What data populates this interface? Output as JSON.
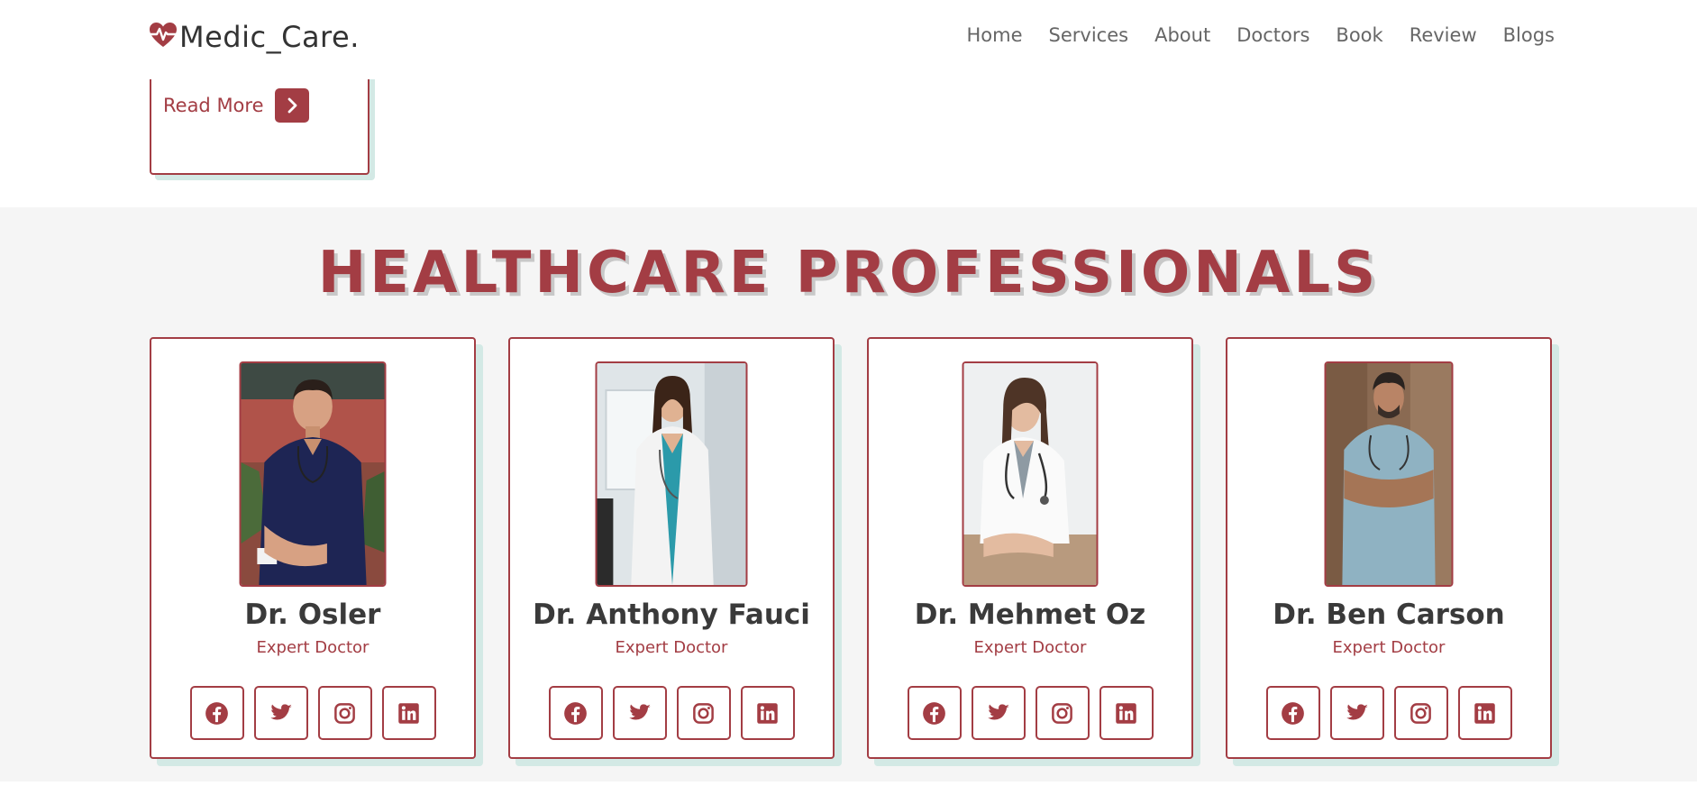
{
  "header": {
    "logo_icon": "heartbeat-icon",
    "logo_text": "Medic_Care.",
    "nav": [
      "Home",
      "Services",
      "About",
      "Doctors",
      "Book",
      "Review",
      "Blogs"
    ]
  },
  "blog": {
    "read_more_label": "Read More",
    "read_more_icon": "chevron-right-icon"
  },
  "section": {
    "title": "HEALTHCARE PROFESSIONALS"
  },
  "doctors": [
    {
      "name": "Dr. Osler",
      "role": "Expert Doctor",
      "photo": "doctor-in-navy-scrubs-photo"
    },
    {
      "name": "Dr. Anthony Fauci",
      "role": "Expert Doctor",
      "photo": "doctor-in-white-coat-standing-photo"
    },
    {
      "name": "Dr. Mehmet Oz",
      "role": "Expert Doctor",
      "photo": "doctor-seated-at-desk-photo"
    },
    {
      "name": "Dr. Ben Carson",
      "role": "Expert Doctor",
      "photo": "doctor-in-blue-scrubs-arms-crossed-photo"
    }
  ],
  "social_icons": [
    "facebook-icon",
    "twitter-icon",
    "instagram-icon",
    "linkedin-icon"
  ],
  "colors": {
    "accent": "#a33d44",
    "section_bg": "#f5f5f5",
    "card_shadow": "#d3e9e5",
    "text_dark": "#3a3a3a",
    "nav_text": "#666666"
  }
}
